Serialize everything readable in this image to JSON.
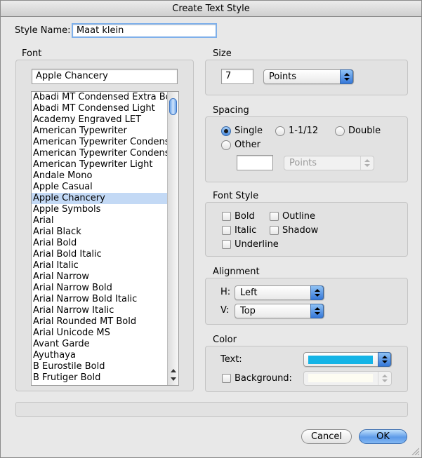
{
  "window": {
    "title": "Create Text Style"
  },
  "style_name": {
    "label": "Style Name:",
    "value": "Maat klein"
  },
  "font": {
    "heading": "Font",
    "current": "Apple Chancery",
    "items": [
      "Abadi MT Condensed Extra Bold",
      "Abadi MT Condensed Light",
      "Academy Engraved LET",
      "American Typewriter",
      "American Typewriter Condensed",
      "American Typewriter Condensed Light",
      "American Typewriter Light",
      "Andale Mono",
      "Apple Casual",
      "Apple Chancery",
      "Apple Symbols",
      "Arial",
      "Arial Black",
      "Arial Bold",
      "Arial Bold Italic",
      "Arial Italic",
      "Arial Narrow",
      "Arial Narrow Bold",
      "Arial Narrow Bold Italic",
      "Arial Narrow Italic",
      "Arial Rounded MT Bold",
      "Arial Unicode MS",
      "Avant Garde",
      "Ayuthaya",
      "B Eurostile Bold",
      "B Frutiger Bold"
    ],
    "selected_index": 9
  },
  "size": {
    "heading": "Size",
    "value": "7",
    "unit": "Points"
  },
  "spacing": {
    "heading": "Spacing",
    "options": [
      "Single",
      "1-1/12",
      "Double",
      "Other"
    ],
    "selected": "Single",
    "other_value": "",
    "other_unit": "Points"
  },
  "font_style": {
    "heading": "Font Style",
    "options": [
      "Bold",
      "Outline",
      "Italic",
      "Shadow",
      "Underline"
    ]
  },
  "alignment": {
    "heading": "Alignment",
    "h_label": "H:",
    "h_value": "Left",
    "v_label": "V:",
    "v_value": "Top"
  },
  "color": {
    "heading": "Color",
    "text_label": "Text:",
    "text_color": "#14b4e6",
    "background_label": "Background:",
    "background_color": "#fdfcf2"
  },
  "buttons": {
    "cancel": "Cancel",
    "ok": "OK"
  },
  "colors": {
    "selection": "#c3d9f5",
    "accent": "#4a8be0"
  }
}
